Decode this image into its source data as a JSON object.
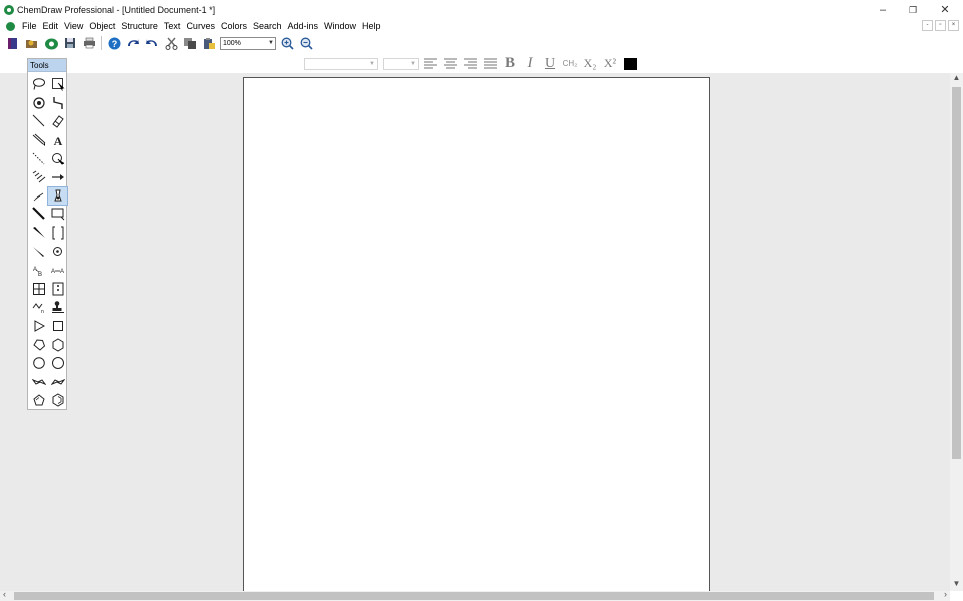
{
  "window": {
    "title": "ChemDraw Professional - [Untitled Document-1 *]",
    "controls": {
      "minimize": "–",
      "restore": "❐",
      "close": "✕"
    }
  },
  "menu": {
    "items": [
      "File",
      "Edit",
      "View",
      "Object",
      "Structure",
      "Text",
      "Curves",
      "Colors",
      "Search",
      "Add-ins",
      "Window",
      "Help"
    ]
  },
  "mdi_controls": {
    "minimize": "-",
    "restore": "▫",
    "close": "×"
  },
  "toolbar": {
    "zoom_value": "100%"
  },
  "format_toolbar": {
    "bold": "B",
    "italic": "I",
    "underline": "U",
    "formula": "CH₂",
    "subscript": "X₂",
    "superscript": "X²"
  },
  "tools_palette": {
    "title": "Tools"
  },
  "colors": {
    "accent": "#1f8a43",
    "palette_header": "#bcd4ee",
    "workspace": "#eaeaea"
  }
}
